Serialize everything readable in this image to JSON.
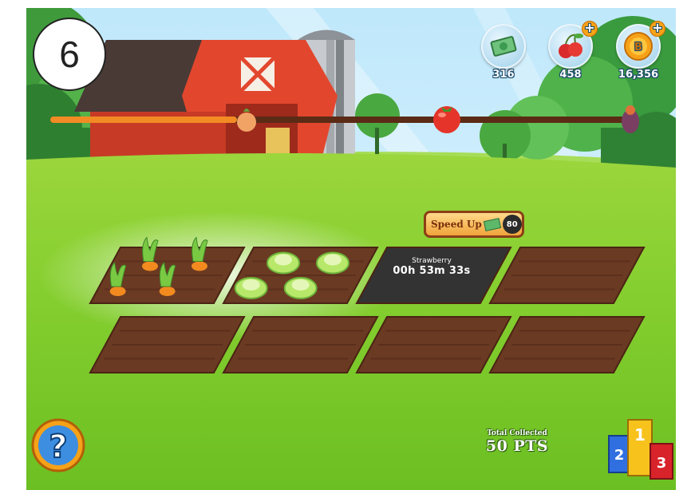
{
  "step_label": "6",
  "resources": [
    {
      "name": "cash",
      "value": "316",
      "has_plus": false
    },
    {
      "name": "cherries",
      "value": "458",
      "has_plus": true
    },
    {
      "name": "coins",
      "value": "16,356",
      "has_plus": true
    }
  ],
  "progress": {
    "markers": [
      "onion-icon",
      "tomato-icon",
      "eggplant-icon"
    ],
    "fill_fraction": 0.32
  },
  "plots": {
    "rows": [
      [
        {
          "state": "grown",
          "crop": "carrot"
        },
        {
          "state": "grown",
          "crop": "lettuce"
        },
        {
          "state": "growing",
          "crop": "Strawberry"
        },
        {
          "state": "empty"
        }
      ],
      [
        {
          "state": "empty"
        },
        {
          "state": "empty"
        },
        {
          "state": "empty"
        },
        {
          "state": "empty"
        }
      ]
    ]
  },
  "speed_up": {
    "label": "Speed Up",
    "cost": "80"
  },
  "timer": {
    "crop": "Strawberry",
    "remaining": "00h 53m 33s"
  },
  "total": {
    "label": "Total Collected",
    "value": "50 PTS"
  },
  "podium": {
    "first": "1",
    "second": "2",
    "third": "3"
  },
  "colors": {
    "grass": "#7fcb2e",
    "sky": "#cfeefc",
    "barn": "#e2472e",
    "soil": "#6b3a22",
    "accent": "#f7a318"
  }
}
